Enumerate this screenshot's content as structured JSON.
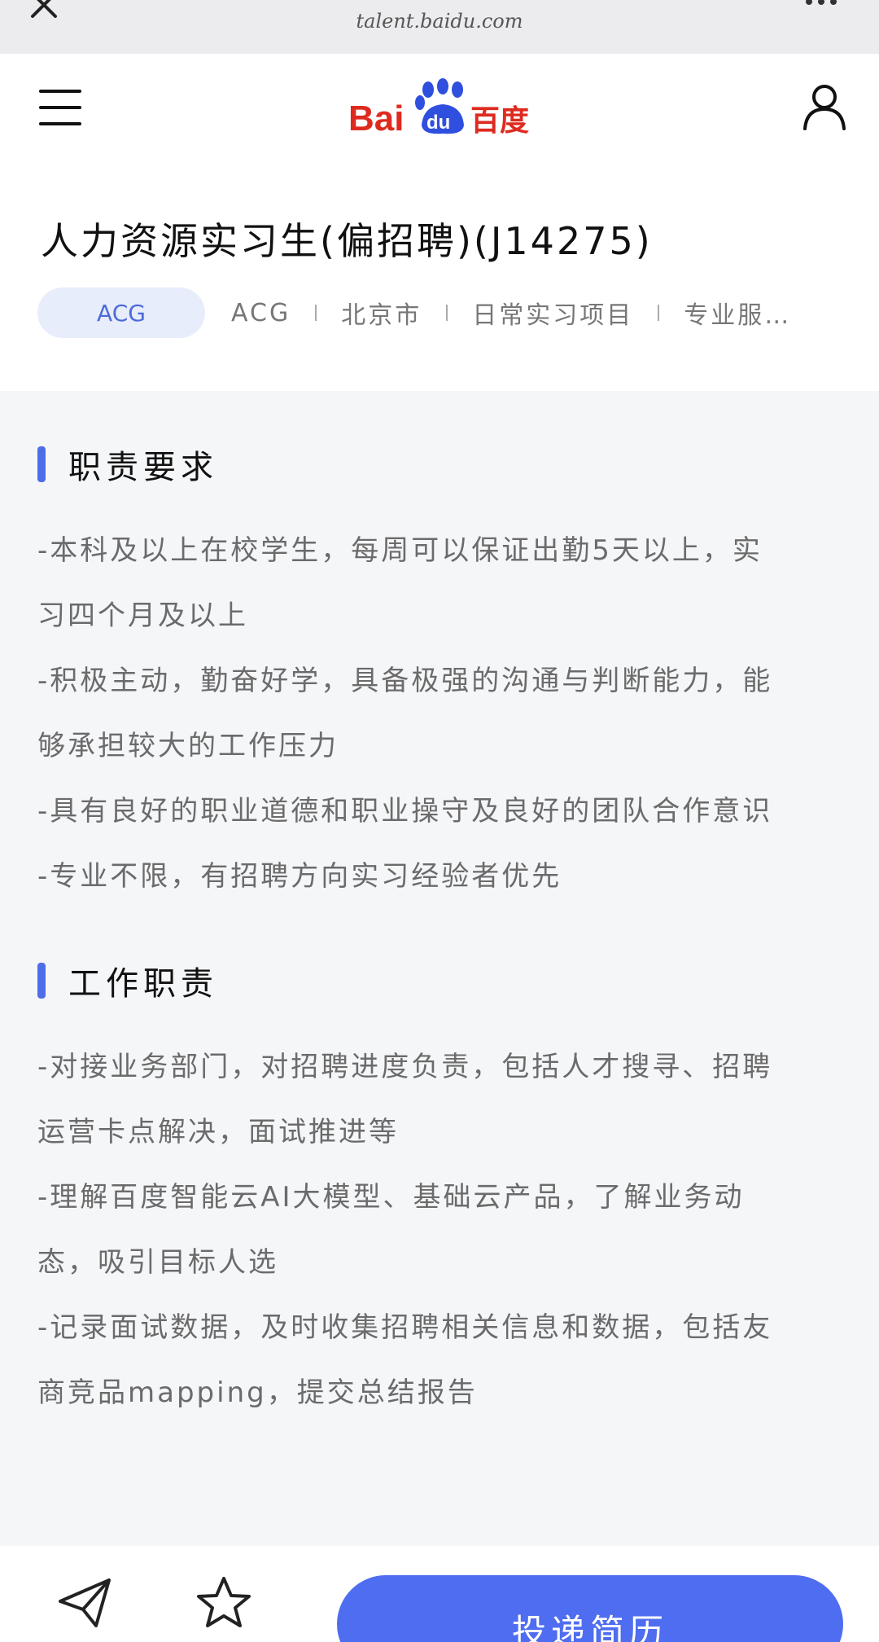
{
  "browser": {
    "url": "talent.baidu.com"
  },
  "header": {
    "logo_text": "Bai du 百度"
  },
  "job": {
    "title": "人力资源实习生(偏招聘)(J14275)",
    "tag": "ACG",
    "meta": [
      "ACG",
      "北京市",
      "日常实习项目",
      "专业服…"
    ]
  },
  "sections": [
    {
      "title": "职责要求",
      "lines": [
        "-本科及以上在校学生，每周可以保证出勤5天以上，实",
        "习四个月及以上",
        "-积极主动，勤奋好学，具备极强的沟通与判断能力，能",
        "够承担较大的工作压力",
        "-具有良好的职业道德和职业操守及良好的团队合作意识",
        "-专业不限，有招聘方向实习经验者优先"
      ]
    },
    {
      "title": "工作职责",
      "lines": [
        "-对接业务部门，对招聘进度负责，包括人才搜寻、招聘",
        "运营卡点解决，面试推进等",
        "-理解百度智能云AI大模型、基础云产品，了解业务动",
        "态，吸引目标人选",
        "-记录面试数据，及时收集招聘相关信息和数据，包括友",
        "商竞品mapping，提交总结报告"
      ]
    }
  ],
  "bottom": {
    "apply_label": "投递简历"
  },
  "colors": {
    "accent": "#4f6df0",
    "tag_bg": "#e8edfc"
  }
}
